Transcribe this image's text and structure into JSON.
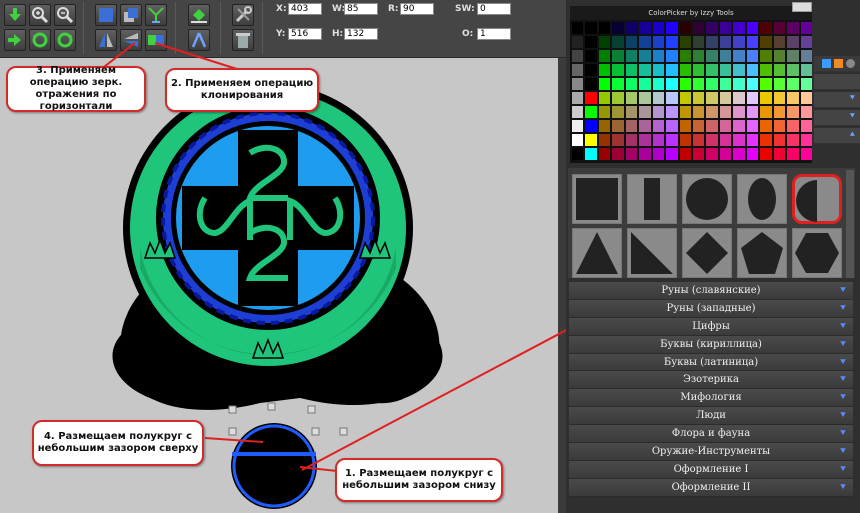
{
  "toolbar": {
    "fields": [
      {
        "label": "X:",
        "value": "403"
      },
      {
        "label": "W:",
        "value": "85"
      },
      {
        "label": "R:",
        "value": "90"
      },
      {
        "label": "SW:",
        "value": "0"
      },
      {
        "label": "Y:",
        "value": "516"
      },
      {
        "label": "H:",
        "value": "132"
      },
      {
        "label": "O:",
        "value": "1"
      }
    ]
  },
  "callouts": {
    "c1": "1. Размещаем полукруг с небольшим зазором снизу",
    "c2": "2. Применяем операцию клонирования",
    "c3": "3. Применяем операцию зерк. отражения по горизонтали",
    "c4": "4. Размещаем полукруг с небольшим зазором сверху"
  },
  "colorpicker": {
    "title": "ColorPicker by Izzy Tools"
  },
  "categories": [
    "Руны (славянские)",
    "Руны (западные)",
    "Цифры",
    "Буквы (кириллица)",
    "Буквы (латиница)",
    "Эзотерика",
    "Мифология",
    "Люди",
    "Флора и фауна",
    "Оружие-Инструменты",
    "Оформление I",
    "Оформление II"
  ],
  "colors": {
    "accent_red": "#d42a2a",
    "logo_green": "#1fc57a",
    "logo_blue": "#1e90ff",
    "chevron": "#5b8bff"
  }
}
